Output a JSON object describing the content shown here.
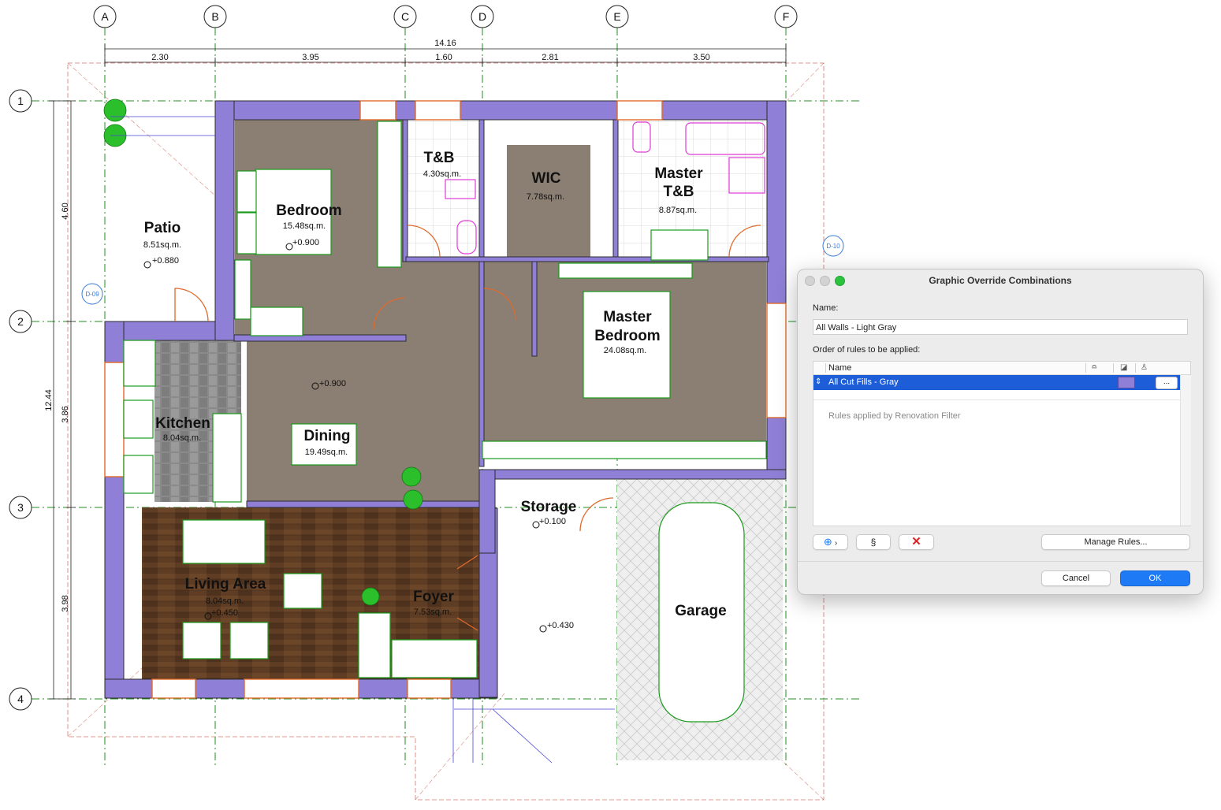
{
  "plan": {
    "grid_columns": [
      "A",
      "B",
      "C",
      "D",
      "E",
      "F"
    ],
    "grid_rows": [
      "1",
      "2",
      "3",
      "4"
    ],
    "overall_width": "14.16",
    "segment_dims": [
      "2.30",
      "3.95",
      "1.60",
      "2.81",
      "3.50"
    ],
    "overall_height": "12.44",
    "vertical_dims": [
      "4.60",
      "3.86",
      "3.98"
    ],
    "rooms": [
      {
        "name": "Patio",
        "area": "8.51sq.m."
      },
      {
        "name": "Bedroom",
        "area": "15.48sq.m."
      },
      {
        "name": "T&B",
        "area": "4.30sq.m."
      },
      {
        "name": "WIC",
        "area": "7.78sq.m."
      },
      {
        "name_line1": "Master",
        "name_line2": "T&B",
        "area": "8.87sq.m."
      },
      {
        "name_line1": "Master",
        "name_line2": "Bedroom",
        "area": "24.08sq.m."
      },
      {
        "name": "Kitchen",
        "area": "8.04sq.m."
      },
      {
        "name": "Dining",
        "area": "19.49sq.m."
      },
      {
        "name": "Storage"
      },
      {
        "name": "Living Area",
        "area": "8.04sq.m."
      },
      {
        "name": "Foyer",
        "area": "7.53sq.m."
      },
      {
        "name": "Garage"
      }
    ],
    "elevations": [
      "+0.880",
      "+0.900",
      "+0.900",
      "+0.100",
      "+0.450",
      "+0.430"
    ],
    "tags": [
      "D-09",
      "D-10"
    ],
    "colors": {
      "wall": "#8f7fd6",
      "wall_edge": "#3a3a3a",
      "floor_tile": "#8b7e73",
      "wood": "#5a3a22",
      "grid_line": "#1f8f1f",
      "furniture": "#1a9a1a",
      "door": "#e06a2c",
      "plumbing": "#e03ad8"
    }
  },
  "dialog": {
    "title": "Graphic Override Combinations",
    "name_label": "Name:",
    "name_value": "All Walls - Light Gray",
    "rules_label": "Order of rules to be applied:",
    "column_name": "Name",
    "rule": {
      "name": "All Cut Fills - Gray",
      "swatch_color": "#8f7fd6",
      "more": "..."
    },
    "renovation_text": "Rules applied by Renovation Filter",
    "manage_rules": "Manage Rules...",
    "cancel": "Cancel",
    "ok": "OK"
  }
}
